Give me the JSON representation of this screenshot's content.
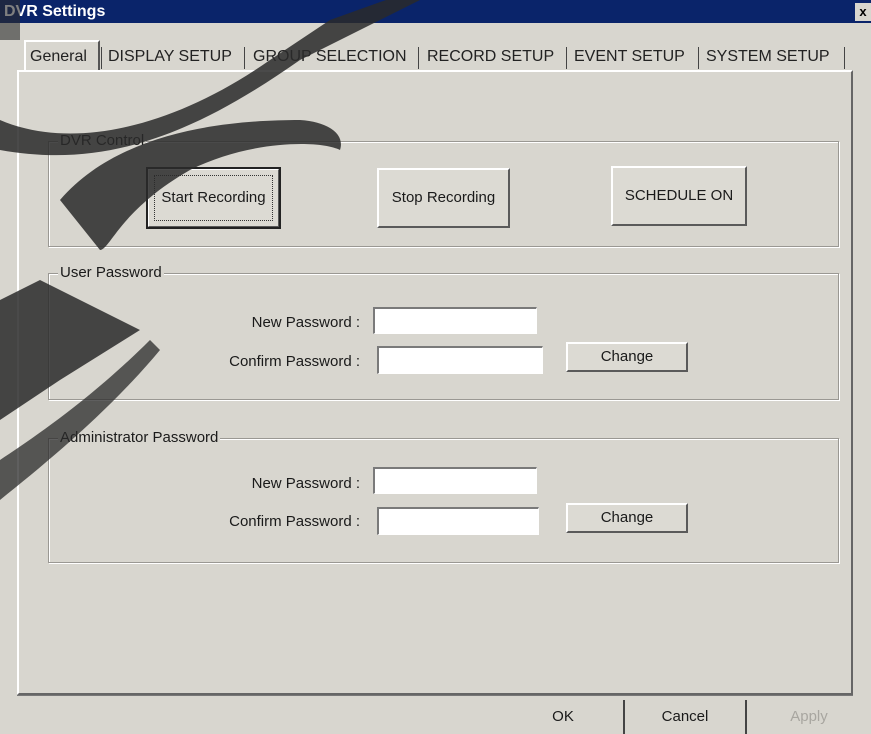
{
  "window": {
    "title": "DVR Settings",
    "close_label": "x"
  },
  "tabs": [
    {
      "label": "General",
      "active": true
    },
    {
      "label": "DISPLAY SETUP"
    },
    {
      "label": "GROUP SELECTION"
    },
    {
      "label": "RECORD SETUP"
    },
    {
      "label": "EVENT SETUP"
    },
    {
      "label": "SYSTEM SETUP"
    }
  ],
  "dvr_control": {
    "title": "DVR Control",
    "start_label": "Start Recording",
    "stop_label": "Stop Recording",
    "schedule_label": "SCHEDULE ON"
  },
  "user_password": {
    "title": "User Password",
    "new_label": "New Password :",
    "confirm_label": "Confirm  Password :",
    "new_value": "",
    "confirm_value": "",
    "change_label": "Change"
  },
  "admin_password": {
    "title": "Administrator Password",
    "new_label": "New Password :",
    "confirm_label": "Confirm  Password :",
    "new_value": "",
    "confirm_value": "",
    "change_label": "Change"
  },
  "footer": {
    "ok_label": "OK",
    "cancel_label": "Cancel",
    "apply_label": "Apply"
  }
}
